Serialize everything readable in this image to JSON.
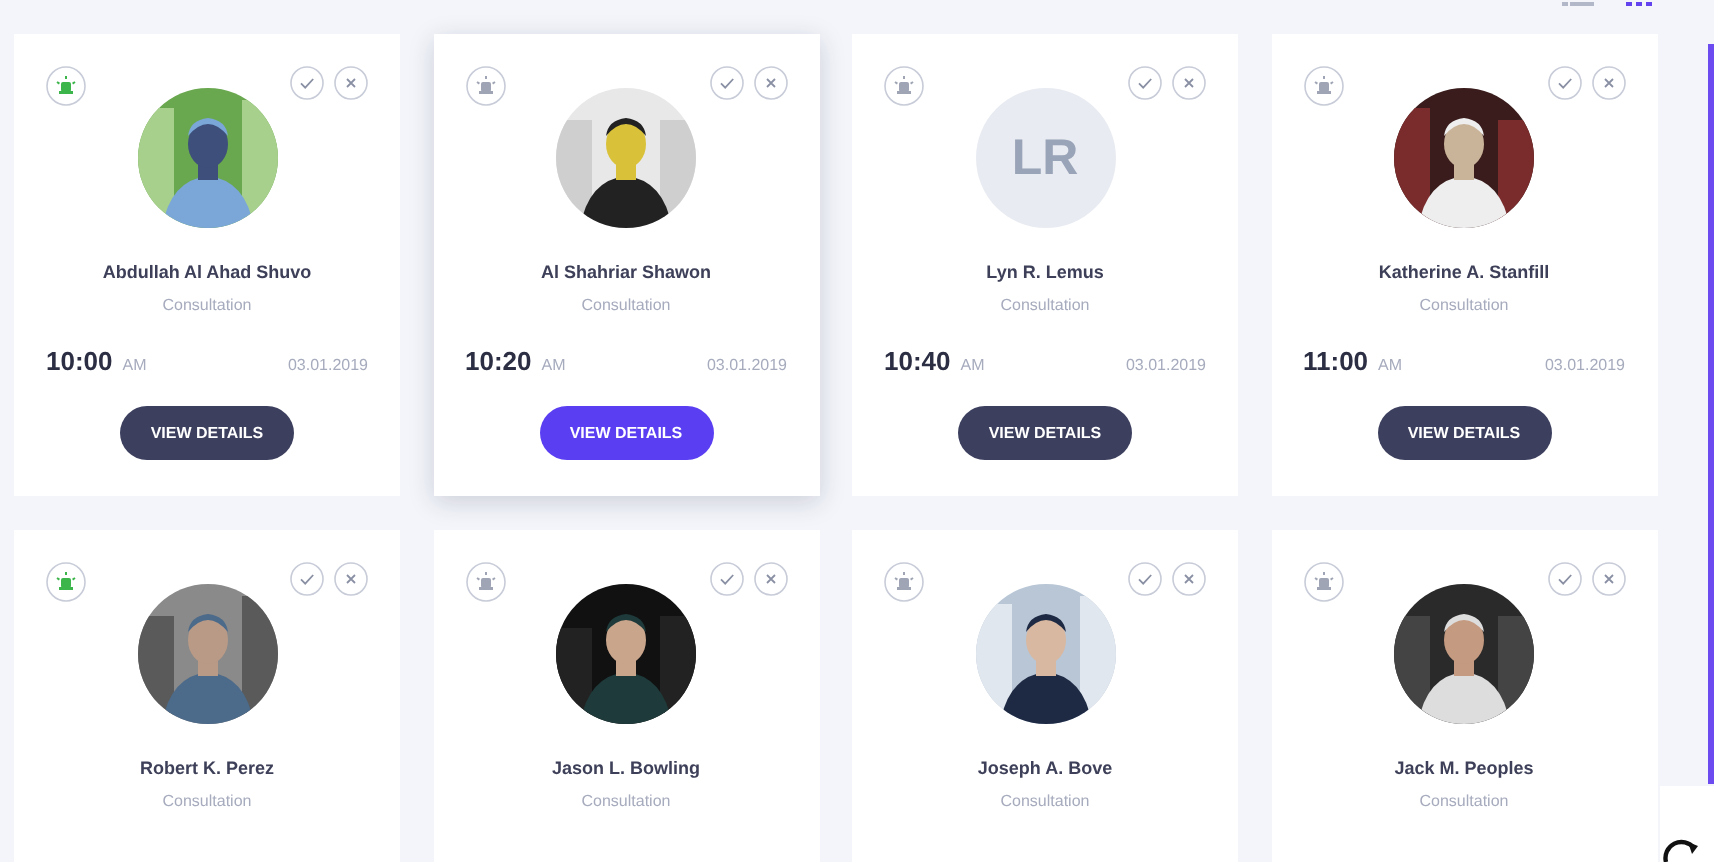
{
  "view_toggle": [
    {
      "kind": "list",
      "selected": false
    },
    {
      "kind": "grid",
      "selected": true
    }
  ],
  "appointments": [
    {
      "name": "Abdullah Al Ahad Shuvo",
      "type": "Consultation",
      "time": "10:00",
      "period": "AM",
      "date": "03.01.2019",
      "button": "VIEW DETAILS",
      "alarm_on": true,
      "selected": false
    },
    {
      "name": "Al Shahriar Shawon",
      "type": "Consultation",
      "time": "10:20",
      "period": "AM",
      "date": "03.01.2019",
      "button": "VIEW DETAILS",
      "alarm_on": false,
      "selected": true
    },
    {
      "name": "Lyn R. Lemus",
      "type": "Consultation",
      "time": "10:40",
      "period": "AM",
      "date": "03.01.2019",
      "button": "VIEW DETAILS",
      "alarm_on": false,
      "selected": false,
      "avatar": {
        "kind": "initials",
        "initials": "LR"
      }
    },
    {
      "name": "Katherine A. Stanfill",
      "type": "Consultation",
      "time": "11:00",
      "period": "AM",
      "date": "03.01.2019",
      "button": "VIEW DETAILS",
      "alarm_on": false,
      "selected": false
    },
    {
      "name": "Robert K. Perez",
      "type": "Consultation",
      "alarm_on": true,
      "selected": false
    },
    {
      "name": "Jason L. Bowling",
      "type": "Consultation",
      "alarm_on": false,
      "selected": false
    },
    {
      "name": "Joseph A. Bove",
      "type": "Consultation",
      "alarm_on": false,
      "selected": false
    },
    {
      "name": "Jack M. Peoples",
      "type": "Consultation",
      "alarm_on": false,
      "selected": false
    }
  ]
}
